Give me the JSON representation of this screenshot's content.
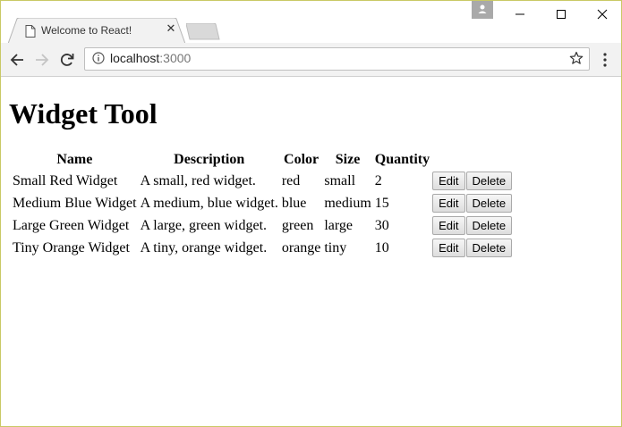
{
  "browser": {
    "tab_title": "Welcome to React!",
    "url_host": "localhost",
    "url_port": ":3000",
    "icons": {
      "tab": "page-icon",
      "close_tab": "close-icon",
      "back": "back-arrow-icon",
      "forward": "forward-arrow-icon",
      "reload": "reload-icon",
      "info": "info-icon",
      "bookmark": "star-icon",
      "menu": "menu-dots-icon",
      "profile": "profile-icon",
      "minimize": "minimize-icon",
      "maximize": "maximize-icon",
      "close_window": "close-window-icon"
    },
    "tab_close_glyph": "✕"
  },
  "page": {
    "title": "Widget Tool",
    "table": {
      "headers": [
        "Name",
        "Description",
        "Color",
        "Size",
        "Quantity"
      ],
      "rows": [
        {
          "name": "Small Red Widget",
          "description": "A small, red widget.",
          "color": "red",
          "size": "small",
          "quantity": "2"
        },
        {
          "name": "Medium Blue Widget",
          "description": "A medium, blue widget.",
          "color": "blue",
          "size": "medium",
          "quantity": "15"
        },
        {
          "name": "Large Green Widget",
          "description": "A large, green widget.",
          "color": "green",
          "size": "large",
          "quantity": "30"
        },
        {
          "name": "Tiny Orange Widget",
          "description": "A tiny, orange widget.",
          "color": "orange",
          "size": "tiny",
          "quantity": "10"
        }
      ],
      "edit_label": "Edit",
      "delete_label": "Delete"
    }
  },
  "colors": {
    "window_border": "#c9c965",
    "toolbar_bg": "#f2f2f2",
    "profile_bg": "#a9a9a9"
  }
}
